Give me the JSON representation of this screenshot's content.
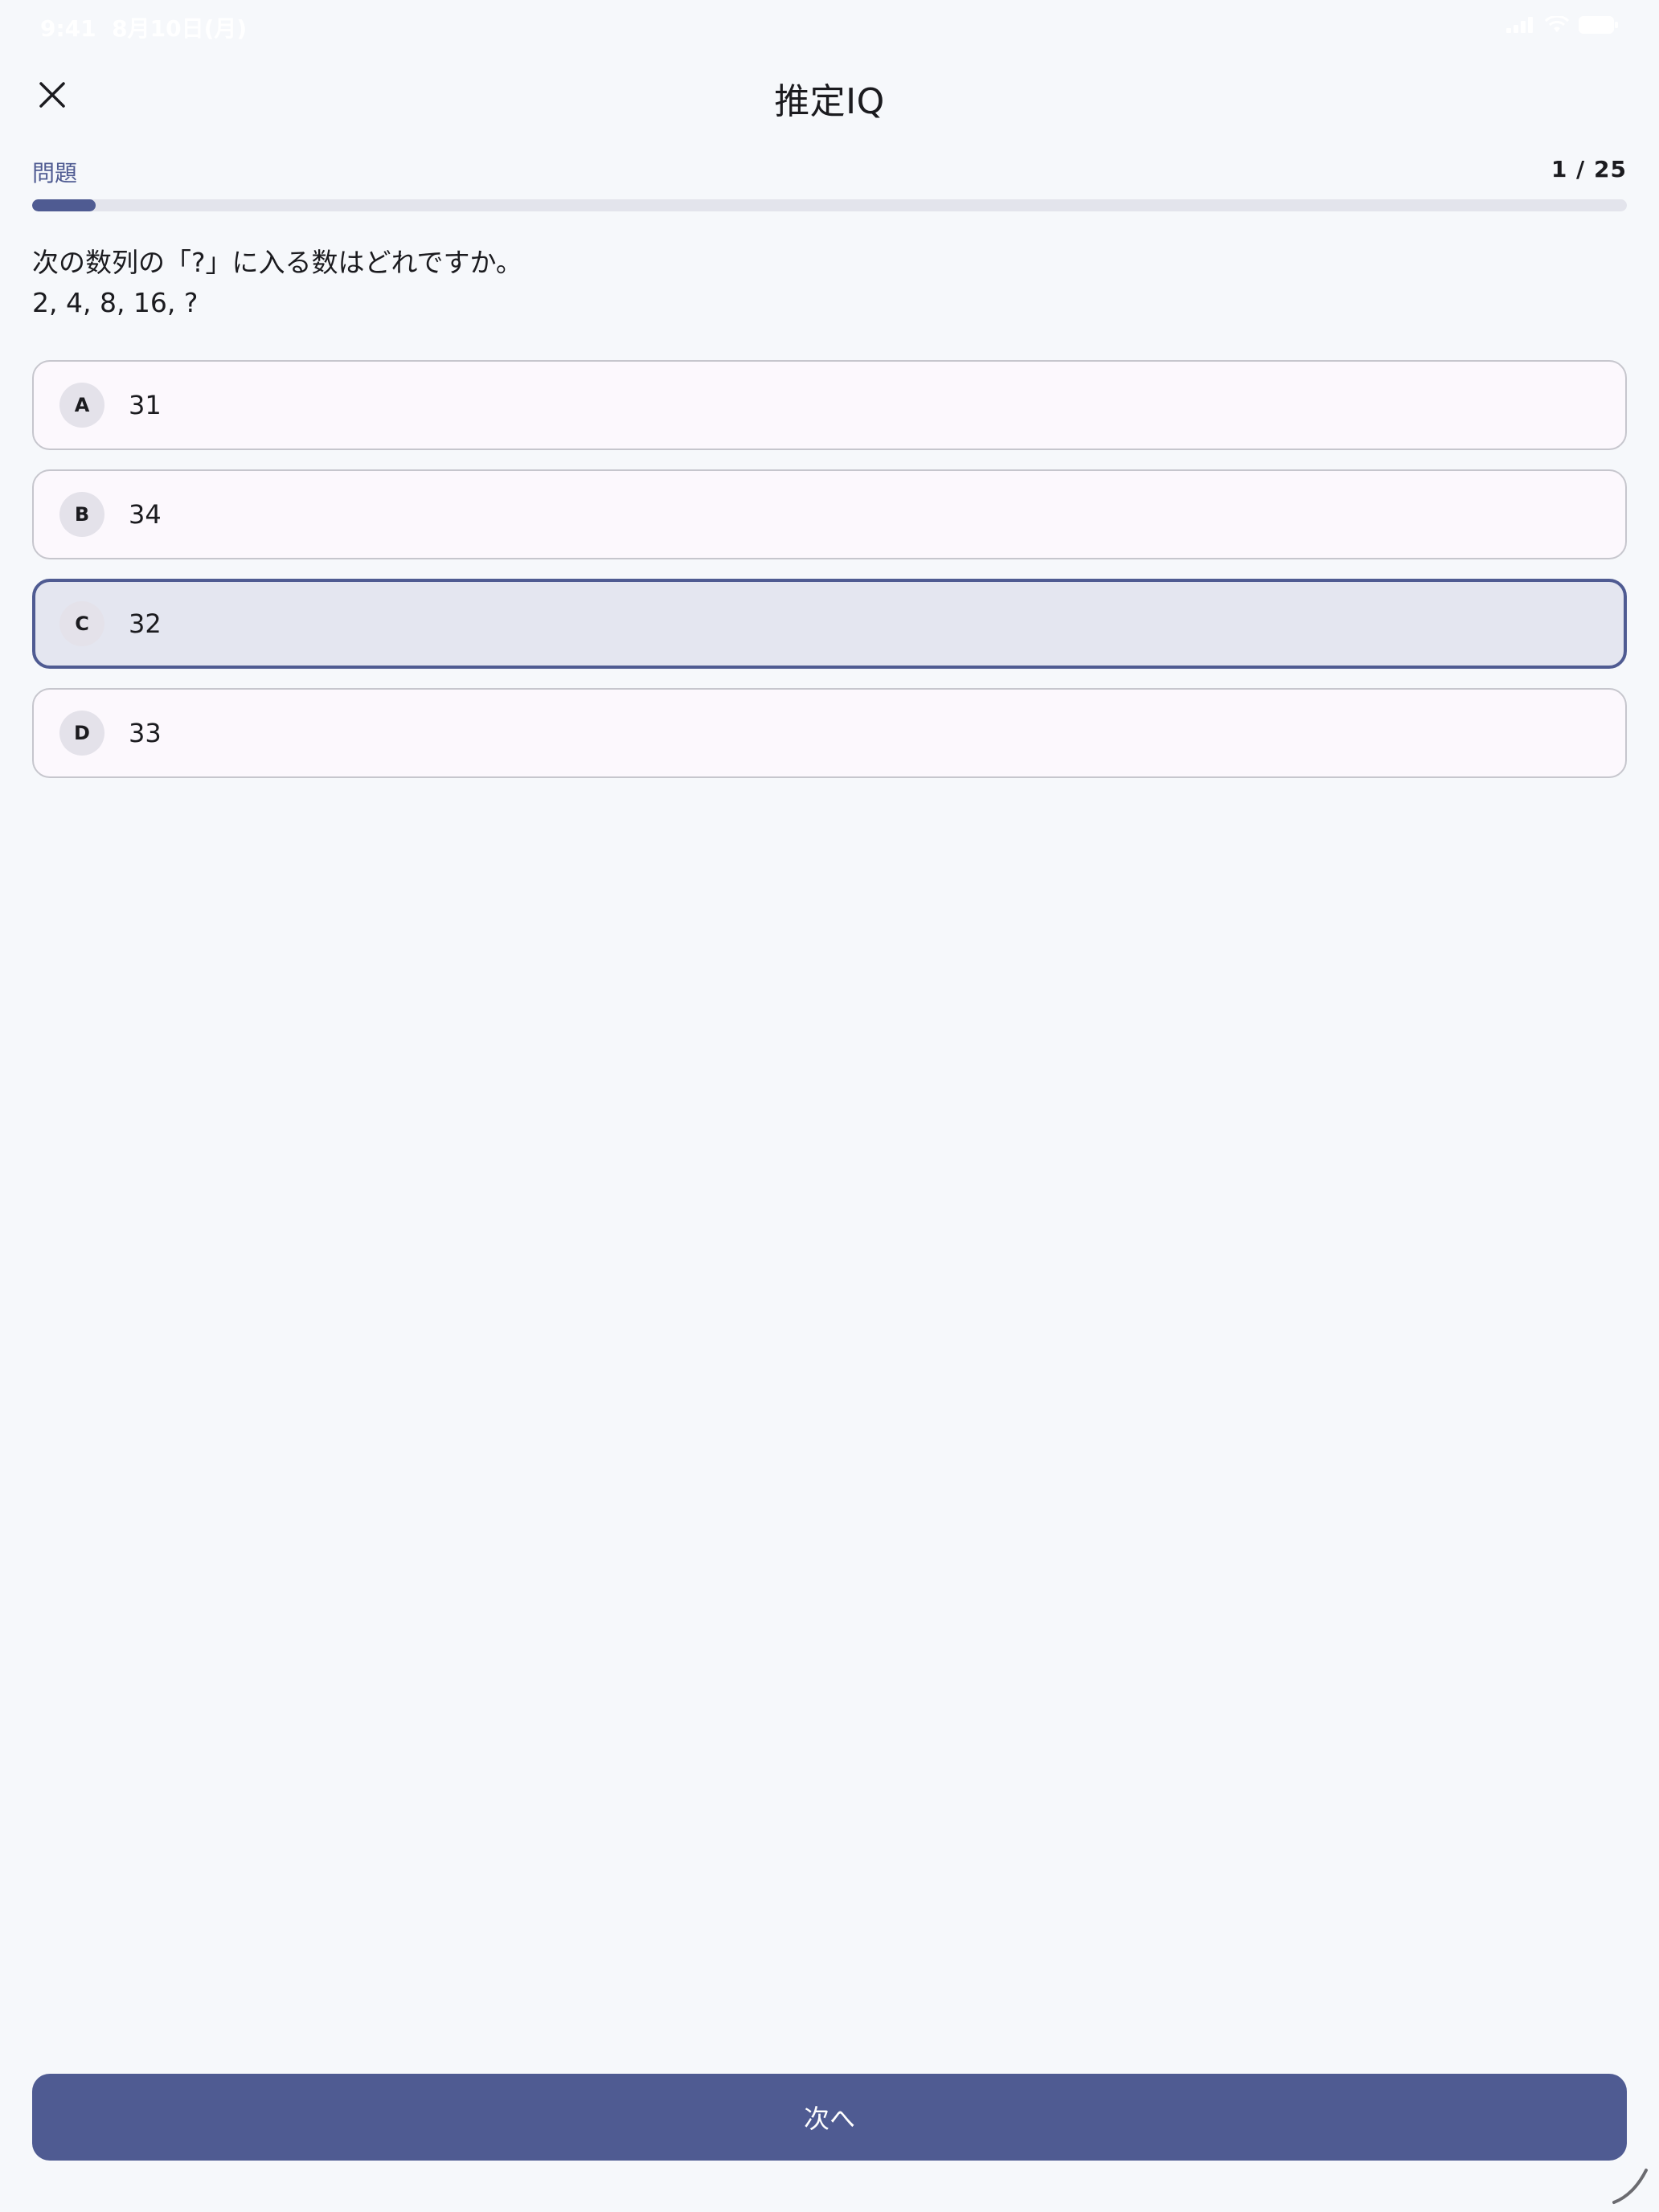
{
  "status_bar": {
    "time": "9:41",
    "date": "8月10日(月)",
    "icons": [
      "cellular-signal-icon",
      "wifi-icon",
      "battery-icon"
    ]
  },
  "header": {
    "close_icon": "close-icon",
    "title": "推定IQ"
  },
  "progress": {
    "label": "問題",
    "count": "1 / 25",
    "current": 1,
    "total": 25,
    "fraction": 0.04
  },
  "question": {
    "line1": "次の数列の「?」に入る数はどれですか。",
    "line2": "2, 4, 8, 16, ?"
  },
  "options": [
    {
      "letter": "A",
      "value": "31",
      "selected": false
    },
    {
      "letter": "B",
      "value": "34",
      "selected": false
    },
    {
      "letter": "C",
      "value": "32",
      "selected": true
    },
    {
      "letter": "D",
      "value": "33",
      "selected": false
    }
  ],
  "next_button": {
    "label": "次へ"
  },
  "colors": {
    "accent": "#4f5b92",
    "background": "#f6f8fb",
    "selected_fill": "#e4e6f0",
    "option_border": "#c6c6cd",
    "progress_track": "#e3e4ec"
  }
}
